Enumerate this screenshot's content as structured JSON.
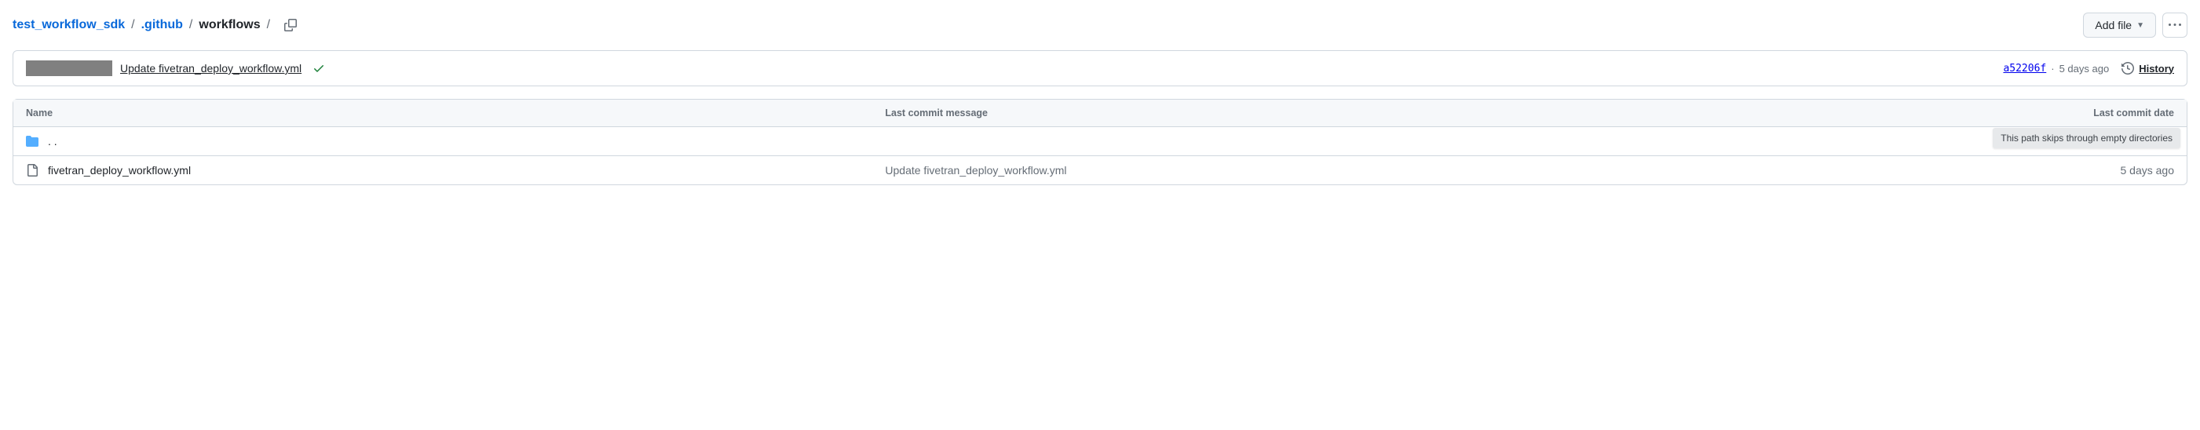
{
  "breadcrumb": {
    "root": "test_workflow_sdk",
    "parent": ".github",
    "current": "workflows",
    "sep": "/"
  },
  "actions": {
    "add_file": "Add file"
  },
  "commit": {
    "message": "Update fivetran_deploy_workflow.yml",
    "sha": "a52206f",
    "dot": "·",
    "age": "5 days ago",
    "history_label": "History"
  },
  "columns": {
    "name": "Name",
    "message": "Last commit message",
    "date": "Last commit date"
  },
  "tooltip": "This path skips through empty directories",
  "rows": {
    "parent": {
      "name": ". ."
    },
    "file1": {
      "name": "fivetran_deploy_workflow.yml",
      "message": "Update fivetran_deploy_workflow.yml",
      "date": "5 days ago"
    }
  }
}
